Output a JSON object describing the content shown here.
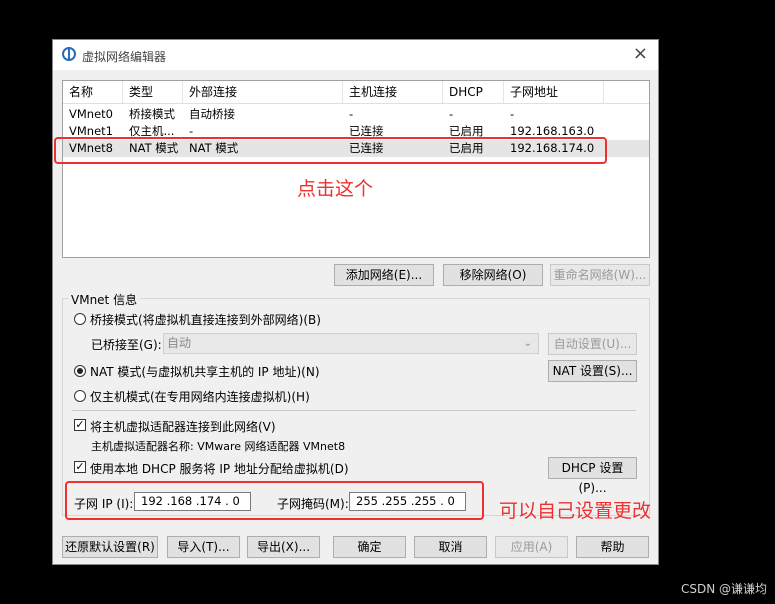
{
  "window": {
    "title": "虚拟网络编辑器",
    "close_label": "×"
  },
  "table": {
    "columns": [
      "名称",
      "类型",
      "外部连接",
      "主机连接",
      "DHCP",
      "子网地址"
    ],
    "rows": [
      [
        "VMnet0",
        "桥接模式",
        "自动桥接",
        "-",
        "-",
        "-"
      ],
      [
        "VMnet1",
        "仅主机...",
        "-",
        "已连接",
        "已启用",
        "192.168.163.0"
      ],
      [
        "VMnet8",
        "NAT 模式",
        "NAT 模式",
        "已连接",
        "已启用",
        "192.168.174.0"
      ]
    ],
    "selected_row": 2
  },
  "annotations": {
    "click_this": "点击这个",
    "can_change": "可以自己设置更改",
    "accent_color": "#ee3030"
  },
  "list_buttons": {
    "add": "添加网络(E)...",
    "remove": "移除网络(O)",
    "rename": "重命名网络(W)..."
  },
  "vmnet_info": {
    "group_title": "VMnet 信息",
    "bridge_radio": "桥接模式(将虚拟机直接连接到外部网络)(B)",
    "bridged_to_label": "已桥接至(G):",
    "bridged_to_value": "自动",
    "auto_settings": "自动设置(U)...",
    "nat_radio": "NAT 模式(与虚拟机共享主机的 IP 地址)(N)",
    "nat_settings": "NAT 设置(S)...",
    "hostonly_radio": "仅主机模式(在专用网络内连接虚拟机)(H)",
    "connect_adapter": "将主机虚拟适配器连接到此网络(V)",
    "adapter_name": "主机虚拟适配器名称: VMware 网络适配器 VMnet8",
    "use_dhcp": "使用本地 DHCP 服务将 IP 地址分配给虚拟机(D)",
    "dhcp_settings": "DHCP 设置(P)...",
    "subnet_ip_label": "子网 IP (I):",
    "subnet_ip_value": "192 .168 .174 . 0",
    "subnet_mask_label": "子网掩码(M):",
    "subnet_mask_value": "255 .255 .255 . 0",
    "selected_mode": "nat",
    "connect_adapter_checked": true,
    "use_dhcp_checked": true
  },
  "bottom_buttons": {
    "restore": "还原默认设置(R)",
    "import": "导入(T)...",
    "export": "导出(X)...",
    "ok": "确定",
    "cancel": "取消",
    "apply": "应用(A)",
    "help": "帮助"
  },
  "watermark": "CSDN @谦谦均"
}
